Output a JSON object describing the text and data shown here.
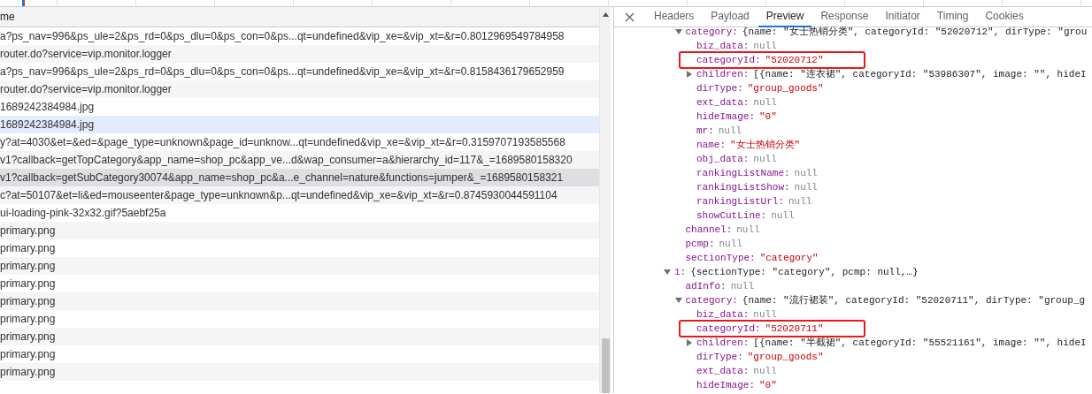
{
  "request_list": {
    "column_header": "me",
    "rows": [
      {
        "name": "a?ps_nav=996&ps_ule=2&ps_rd=0&ps_dlu=0&ps_con=0&ps...qt=undefined&vip_xe=&vip_xt=&r=0.8012969549784958",
        "selected": false,
        "hovered": false
      },
      {
        "name": "router.do?service=vip.monitor.logger",
        "selected": false,
        "hovered": false
      },
      {
        "name": "a?ps_nav=996&ps_ule=2&ps_rd=0&ps_dlu=0&ps_con=0&ps...qt=undefined&vip_xe=&vip_xt=&r=0.8158436179652959",
        "selected": false,
        "hovered": false
      },
      {
        "name": "router.do?service=vip.monitor.logger",
        "selected": false,
        "hovered": false
      },
      {
        "name": "1689242384984.jpg",
        "selected": false,
        "hovered": false
      },
      {
        "name": "1689242384984.jpg",
        "selected": false,
        "hovered": true
      },
      {
        "name": "y?at=4030&et=&ed=&page_type=unknown&page_id=unknow...qt=undefined&vip_xe=&vip_xt=&r=0.3159707193585568",
        "selected": false,
        "hovered": false
      },
      {
        "name": "v1?callback=getTopCategory&app_name=shop_pc&app_ve...d&wap_consumer=a&hierarchy_id=117&_=1689580158320",
        "selected": false,
        "hovered": false
      },
      {
        "name": "v1?callback=getSubCategory30074&app_name=shop_pc&a...e_channel=nature&functions=jumper&_=1689580158321",
        "selected": true,
        "hovered": false
      },
      {
        "name": "c?at=50107&et=li&ed=mouseenter&page_type=unknown&p...qt=undefined&vip_xe=&vip_xt=&r=0.8745930044591104",
        "selected": false,
        "hovered": false
      },
      {
        "name": "ui-loading-pink-32x32.gif?5aebf25a",
        "selected": false,
        "hovered": false
      },
      {
        "name": "primary.png",
        "selected": false,
        "hovered": false
      },
      {
        "name": "primary.png",
        "selected": false,
        "hovered": false
      },
      {
        "name": "primary.png",
        "selected": false,
        "hovered": false
      },
      {
        "name": "primary.png",
        "selected": false,
        "hovered": false
      },
      {
        "name": "primary.png",
        "selected": false,
        "hovered": false
      },
      {
        "name": "primary.png",
        "selected": false,
        "hovered": false
      },
      {
        "name": "primary.png",
        "selected": false,
        "hovered": false
      },
      {
        "name": "primary.png",
        "selected": false,
        "hovered": false
      },
      {
        "name": "primary.png",
        "selected": false,
        "hovered": false
      }
    ]
  },
  "details": {
    "tabs": [
      {
        "label": "Headers",
        "selected": false
      },
      {
        "label": "Payload",
        "selected": false
      },
      {
        "label": "Preview",
        "selected": true
      },
      {
        "label": "Response",
        "selected": false
      },
      {
        "label": "Initiator",
        "selected": false
      },
      {
        "label": "Timing",
        "selected": false
      },
      {
        "label": "Cookies",
        "selected": false
      }
    ],
    "tree_tail": [
      {
        "key": "category:",
        "value": "{name: \"女士热销分类\", categoryId: \"52020712\", dirType: \"grou",
        "kind": "preview",
        "expanded": true,
        "highlighted": false,
        "children": [
          {
            "key": "biz_data:",
            "value": "null",
            "kind": "null",
            "highlighted": false
          },
          {
            "key": "categoryId:",
            "value": "\"52020712\"",
            "kind": "string",
            "highlighted": true
          },
          {
            "key": "children:",
            "value": "[{name: \"连衣裙\", categoryId: \"53986307\", image: \"\", hideI",
            "kind": "preview",
            "expanded": false,
            "highlighted": false
          },
          {
            "key": "dirType:",
            "value": "\"group_goods\"",
            "kind": "string",
            "highlighted": false
          },
          {
            "key": "ext_data:",
            "value": "null",
            "kind": "null",
            "highlighted": false
          },
          {
            "key": "hideImage:",
            "value": "\"0\"",
            "kind": "string",
            "highlighted": false
          },
          {
            "key": "mr:",
            "value": "null",
            "kind": "null",
            "highlighted": false
          },
          {
            "key": "name:",
            "value": "\"女士热销分类\"",
            "kind": "string",
            "highlighted": false
          },
          {
            "key": "obj_data:",
            "value": "null",
            "kind": "null",
            "highlighted": false
          },
          {
            "key": "rankingListName:",
            "value": "null",
            "kind": "null",
            "highlighted": false
          },
          {
            "key": "rankingListShow:",
            "value": "null",
            "kind": "null",
            "highlighted": false
          },
          {
            "key": "rankingListUrl:",
            "value": "null",
            "kind": "null",
            "highlighted": false
          },
          {
            "key": "showCutLine:",
            "value": "null",
            "kind": "null",
            "highlighted": false
          }
        ]
      },
      {
        "key": "channel:",
        "value": "null",
        "kind": "null",
        "highlighted": false
      },
      {
        "key": "pcmp:",
        "value": "null",
        "kind": "null",
        "highlighted": false
      },
      {
        "key": "sectionType:",
        "value": "\"category\"",
        "kind": "string",
        "highlighted": false
      }
    ],
    "tree": [
      {
        "key": "1:",
        "value": "{sectionType: \"category\", pcmp: null,…}",
        "kind": "preview",
        "expanded": true,
        "highlighted": false,
        "children": [
          {
            "key": "adInfo:",
            "value": "null",
            "kind": "null",
            "highlighted": false
          },
          {
            "key": "category:",
            "value": "{name: \"流行裙装\", categoryId: \"52020711\", dirType: \"group_g",
            "kind": "preview",
            "expanded": true,
            "highlighted": false,
            "children": [
              {
                "key": "biz_data:",
                "value": "null",
                "kind": "null",
                "highlighted": false
              },
              {
                "key": "categoryId:",
                "value": "\"52020711\"",
                "kind": "string",
                "highlighted": true
              },
              {
                "key": "children:",
                "value": "[{name: \"半截裙\", categoryId: \"55521161\", image: \"\", hideI",
                "kind": "preview",
                "expanded": false,
                "highlighted": false
              },
              {
                "key": "dirType:",
                "value": "\"group_goods\"",
                "kind": "string",
                "highlighted": false
              },
              {
                "key": "ext_data:",
                "value": "null",
                "kind": "null",
                "highlighted": false
              },
              {
                "key": "hideImage:",
                "value": "\"0\"",
                "kind": "string",
                "highlighted": false
              }
            ]
          }
        ]
      }
    ]
  }
}
